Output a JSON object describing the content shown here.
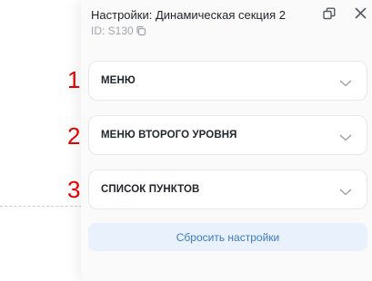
{
  "panel": {
    "title": "Настройки: Динамическая секция 2",
    "id_text": "ID: S130"
  },
  "sections": [
    {
      "label": "МЕНЮ",
      "marker": "1"
    },
    {
      "label": "МЕНЮ ВТОРОГО УРОВНЯ",
      "marker": "2"
    },
    {
      "label": "СПИСОК ПУНКТОВ",
      "marker": "3"
    }
  ],
  "reset_button": {
    "label": "Сбросить настройки"
  },
  "colors": {
    "accent": "#3d79c4",
    "reset_bg": "#e9f1fc",
    "marker": "#e50000"
  },
  "icons": {
    "copy": "copy-icon",
    "detach": "detach-window-icon",
    "close": "close-icon",
    "chevron": "chevron-down-icon"
  }
}
